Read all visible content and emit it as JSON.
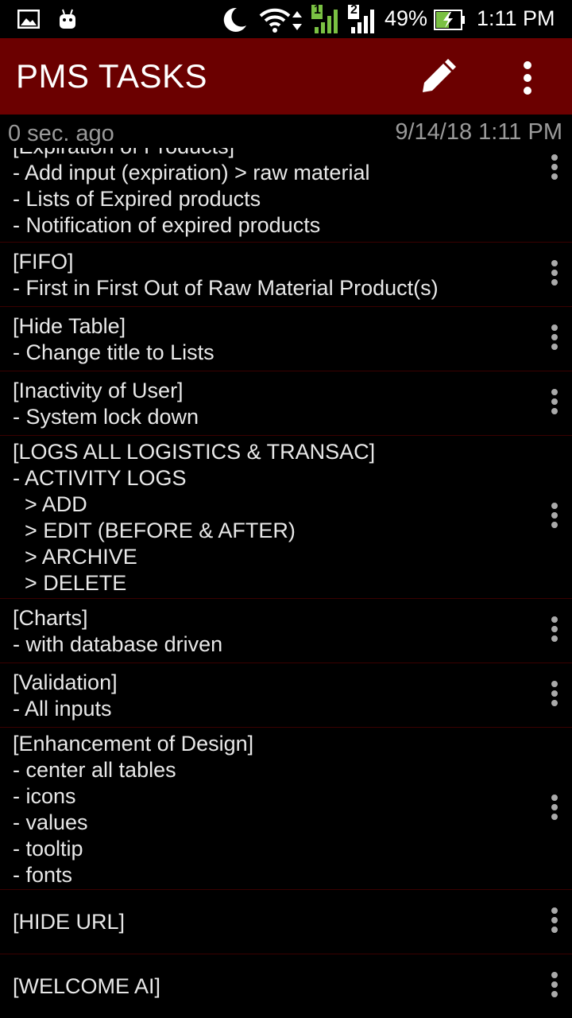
{
  "status_bar": {
    "battery": "49%",
    "time": "1:11 PM",
    "sim1": "1",
    "sim2": "2"
  },
  "app_bar": {
    "title": "PMS TASKS",
    "edit_icon": "pencil-icon",
    "menu_icon": "more-vert-icon"
  },
  "sub_header": {
    "ago": "0 sec. ago",
    "timestamp": "9/14/18 1:11 PM"
  },
  "tasks": [
    {
      "text": "[Expiration of Products]\n- Add input (expiration) > raw material\n- Lists of Expired products\n- Notification of expired products"
    },
    {
      "text": "[FIFO]\n- First in First Out of Raw Material Product(s)"
    },
    {
      "text": "[Hide Table]\n- Change title to Lists"
    },
    {
      "text": "[Inactivity of User]\n- System lock down"
    },
    {
      "text": "[LOGS ALL LOGISTICS & TRANSAC]\n- ACTIVITY LOGS\n  > ADD\n  > EDIT (BEFORE & AFTER)\n  > ARCHIVE\n  > DELETE"
    },
    {
      "text": "[Charts]\n- with database driven"
    },
    {
      "text": "[Validation]\n- All inputs"
    },
    {
      "text": "[Enhancement of Design]\n- center all tables\n- icons\n- values\n- tooltip\n- fonts"
    },
    {
      "text": "[HIDE URL]"
    },
    {
      "text": "[WELCOME AI]"
    }
  ],
  "colors": {
    "app_bar": "#6b0000",
    "background": "#000000",
    "divider": "#3a0000",
    "battery_accent": "#7ac143"
  }
}
